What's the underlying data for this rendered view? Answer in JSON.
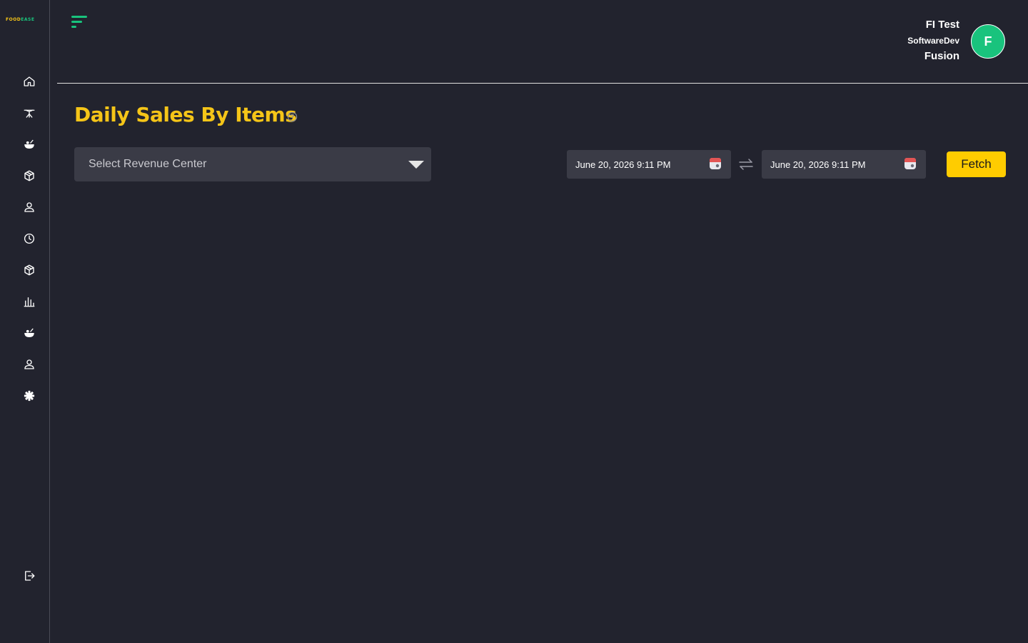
{
  "brand": {
    "logo_part1": "FOOD",
    "logo_part2": "EASE"
  },
  "sidebar": {
    "items": [
      {
        "icon": "home-icon"
      },
      {
        "icon": "dining-table-icon"
      },
      {
        "icon": "food-bowl-icon"
      },
      {
        "icon": "box-icon"
      },
      {
        "icon": "user-icon"
      },
      {
        "icon": "clock-icon"
      },
      {
        "icon": "box-icon"
      },
      {
        "icon": "bar-chart-icon"
      },
      {
        "icon": "food-bowl-icon"
      },
      {
        "icon": "user-icon"
      },
      {
        "icon": "gear-icon"
      }
    ],
    "logout_icon": "logout-icon"
  },
  "header": {
    "user_line1": "FI Test",
    "user_line2": "SoftwareDev",
    "user_line3": "Fusion",
    "avatar_initial": "F"
  },
  "main": {
    "title": "Daily Sales By Items",
    "revenue_center_placeholder": "Select Revenue Center",
    "start_date": "June 20, 2026 9:11 PM",
    "end_date": "June 20, 2026 9:11 PM",
    "fetch_label": "Fetch"
  },
  "colors": {
    "background": "#22232e",
    "accent_yellow": "#f5c518",
    "accent_green": "#19c37d",
    "field_bg": "#3a3b46"
  }
}
